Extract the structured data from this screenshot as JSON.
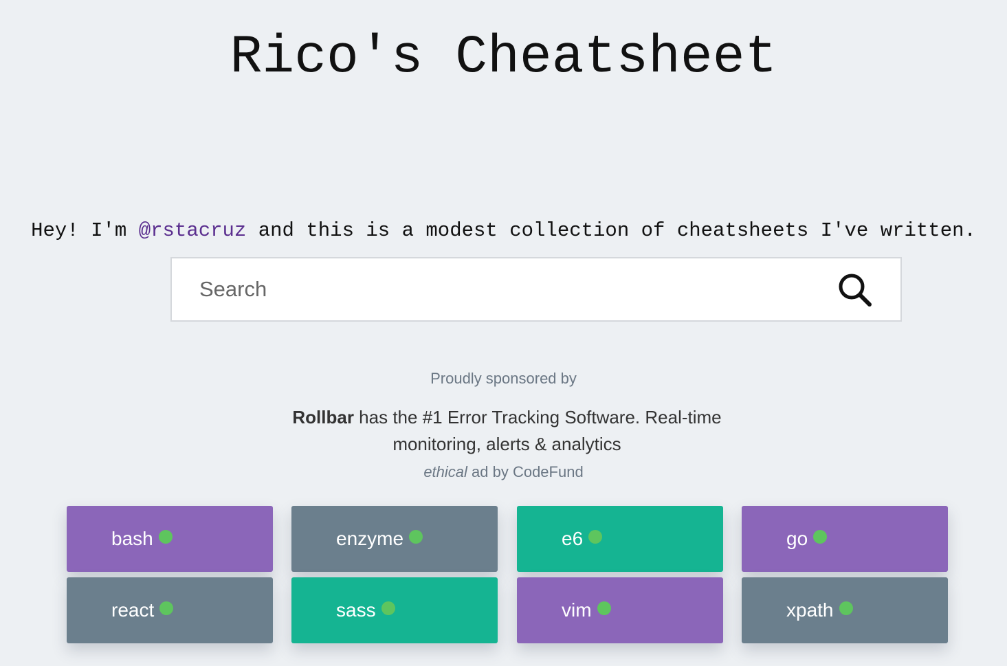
{
  "header": {
    "title": "Rico's Cheatsheet"
  },
  "intro": {
    "before": "Hey! I'm ",
    "handle": "@rstacruz",
    "after": " and this is a modest collection of cheatsheets I've written."
  },
  "search": {
    "placeholder": "Search",
    "value": ""
  },
  "sponsor": {
    "label": "Proudly sponsored by",
    "brand": "Rollbar",
    "text": " has the #1 Error Tracking Software. Real-time monitoring, alerts & analytics",
    "footer_em": "ethical",
    "footer_rest": " ad by CodeFund"
  },
  "colors": {
    "purple": "#8b66b9",
    "slate": "#6b7f8d",
    "teal": "#15b492",
    "dot": "#5ec55e"
  },
  "tiles": [
    {
      "label": "bash",
      "color": "purple"
    },
    {
      "label": "enzyme",
      "color": "slate"
    },
    {
      "label": "e6",
      "color": "teal"
    },
    {
      "label": "go",
      "color": "purple"
    },
    {
      "label": "react",
      "color": "slate"
    },
    {
      "label": "sass",
      "color": "teal"
    },
    {
      "label": "vim",
      "color": "purple"
    },
    {
      "label": "xpath",
      "color": "slate"
    }
  ]
}
